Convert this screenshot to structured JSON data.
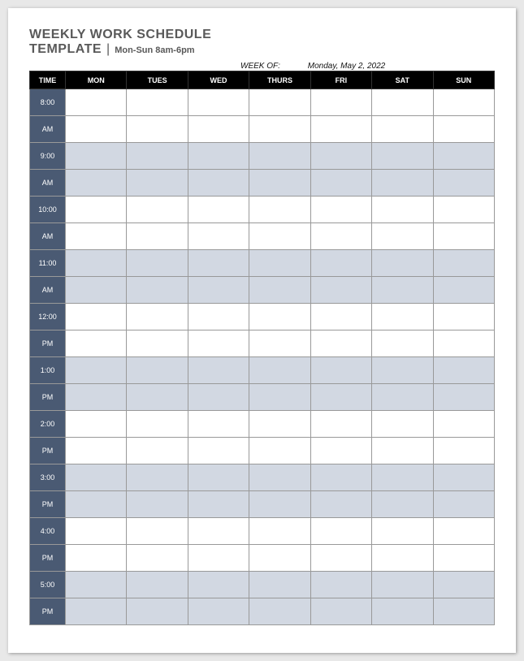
{
  "title": {
    "line1": "WEEKLY WORK SCHEDULE",
    "line2_template": "TEMPLATE",
    "line2_range": "Mon-Sun 8am-6pm"
  },
  "week_of": {
    "label": "WEEK OF:",
    "date": "Monday, May 2, 2022"
  },
  "headers": {
    "time": "TIME",
    "days": [
      "MON",
      "TUES",
      "WED",
      "THURS",
      "FRI",
      "SAT",
      "SUN"
    ]
  },
  "time_rows": [
    {
      "hour": "8:00",
      "ampm": "AM",
      "shaded": false
    },
    {
      "hour": "9:00",
      "ampm": "AM",
      "shaded": true
    },
    {
      "hour": "10:00",
      "ampm": "AM",
      "shaded": false
    },
    {
      "hour": "11:00",
      "ampm": "AM",
      "shaded": true
    },
    {
      "hour": "12:00",
      "ampm": "PM",
      "shaded": false
    },
    {
      "hour": "1:00",
      "ampm": "PM",
      "shaded": true
    },
    {
      "hour": "2:00",
      "ampm": "PM",
      "shaded": false
    },
    {
      "hour": "3:00",
      "ampm": "PM",
      "shaded": true
    },
    {
      "hour": "4:00",
      "ampm": "PM",
      "shaded": false
    },
    {
      "hour": "5:00",
      "ampm": "PM",
      "shaded": true
    }
  ],
  "colors": {
    "header_bg": "#000000",
    "time_col_bg": "#4a5a73",
    "shade_bg": "#d2d8e2"
  }
}
